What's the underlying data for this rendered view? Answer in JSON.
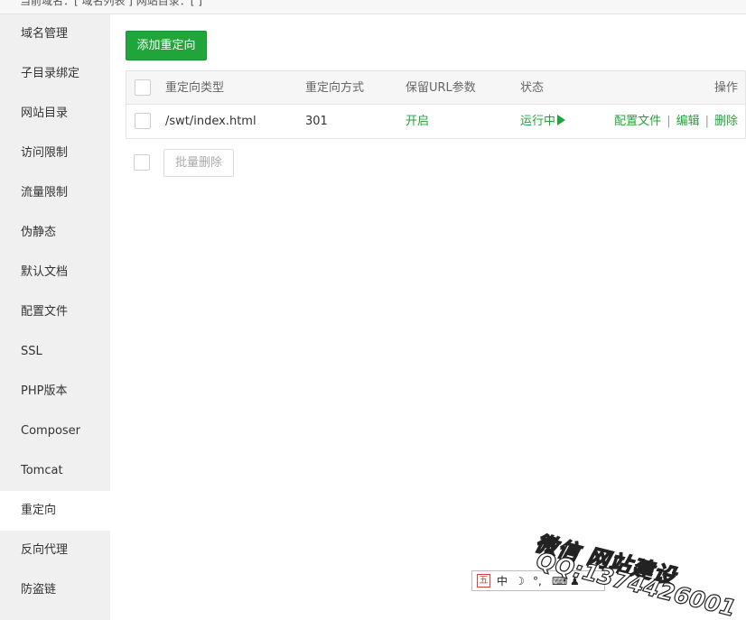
{
  "topbar": {
    "text": "当前域名：[  域名列表  ]   网站目录：[               ]"
  },
  "sidebar": {
    "items": [
      {
        "label": "域名管理"
      },
      {
        "label": "子目录绑定"
      },
      {
        "label": "网站目录"
      },
      {
        "label": "访问限制"
      },
      {
        "label": "流量限制"
      },
      {
        "label": "伪静态"
      },
      {
        "label": "默认文档"
      },
      {
        "label": "配置文件"
      },
      {
        "label": "SSL"
      },
      {
        "label": "PHP版本"
      },
      {
        "label": "Composer"
      },
      {
        "label": "Tomcat"
      },
      {
        "label": "重定向"
      },
      {
        "label": "反向代理"
      },
      {
        "label": "防盗链"
      }
    ],
    "active": "重定向"
  },
  "main": {
    "add_button": "添加重定向",
    "table": {
      "headers": {
        "type": "重定向类型",
        "method": "重定向方式",
        "keep_url": "保留URL参数",
        "status": "状态",
        "ops": "操作"
      },
      "rows": [
        {
          "type": "/swt/index.html",
          "method": "301",
          "keep_url": "开启",
          "status": "运行中",
          "op_config": "配置文件",
          "op_edit": "编辑",
          "op_delete": "删除"
        }
      ],
      "separator": "|"
    },
    "batch_delete": "批量删除"
  },
  "ime": {
    "wu": "五",
    "zh": "中",
    "moon": "☽",
    "punct": "°,",
    "keyboard": "⌨",
    "user": "♟"
  },
  "watermark": {
    "line1": "微信    网站建设",
    "line2": "QQ:1374426001"
  },
  "colors": {
    "accent": "#20a53a",
    "sidebar_bg": "#f0f0f1"
  }
}
